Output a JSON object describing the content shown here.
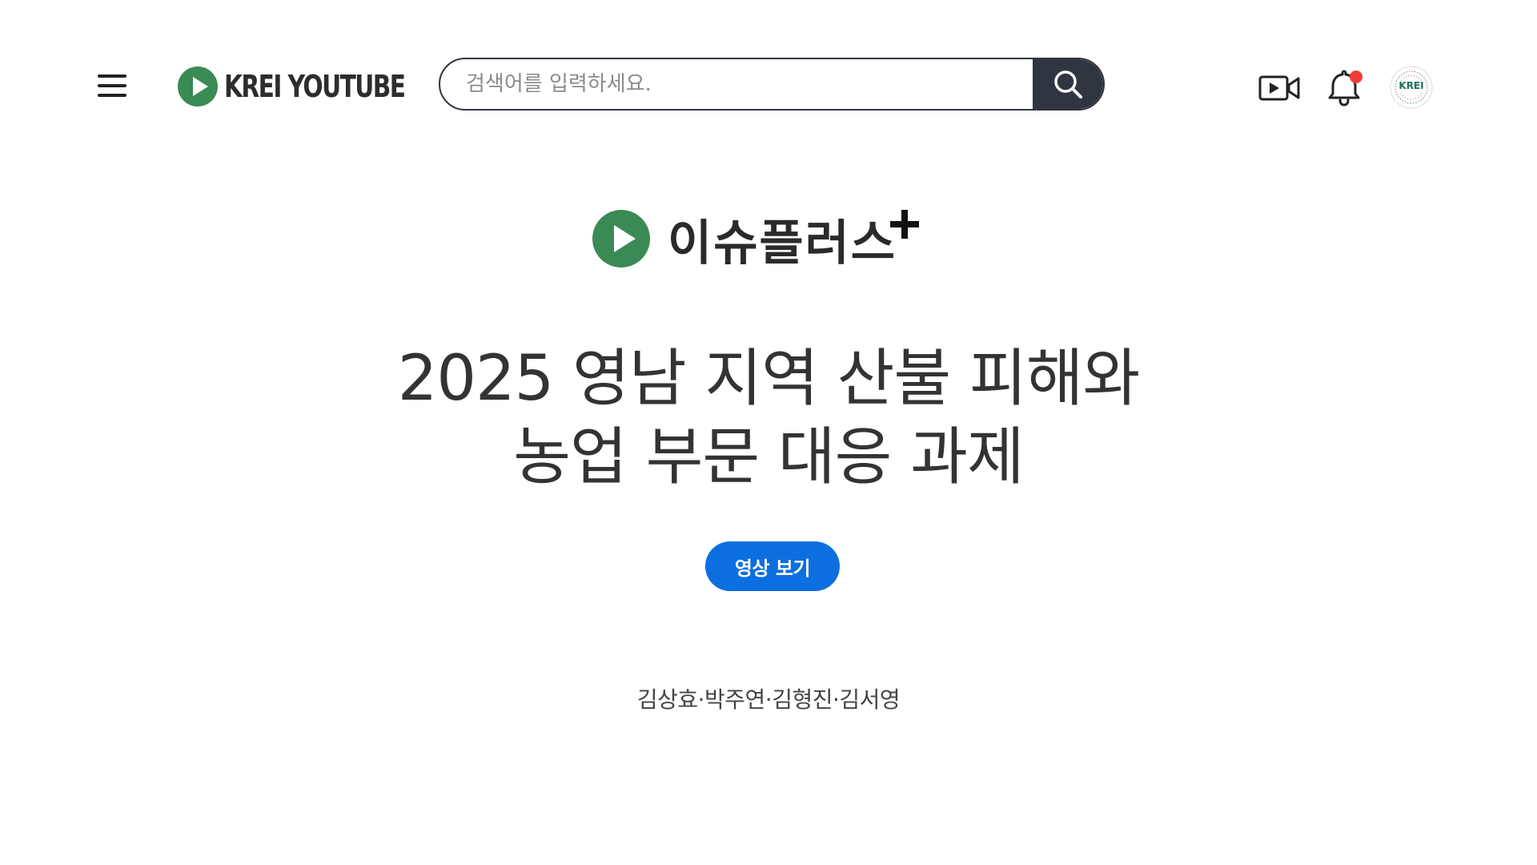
{
  "header": {
    "logo_text": "KREI YOUTUBE",
    "search": {
      "placeholder": "검색어를 입력하세요.",
      "value": ""
    },
    "avatar_label": "KREI"
  },
  "hero": {
    "brand": "이슈플러스",
    "title_line1": "2025 영남 지역 산불 피해와",
    "title_line2": "농업 부문 대응 과제",
    "watch_button": "영상 보기",
    "authors": "김상효·박주연·김형진·김서영"
  },
  "colors": {
    "brand_green": "#3a8a55",
    "search_button": "#2f3640",
    "primary_button": "#0b6fe0",
    "notification_dot": "#f03b3b"
  },
  "icons": [
    "menu-icon",
    "play-logo-icon",
    "search-icon",
    "video-camera-icon",
    "bell-icon",
    "krei-avatar"
  ]
}
